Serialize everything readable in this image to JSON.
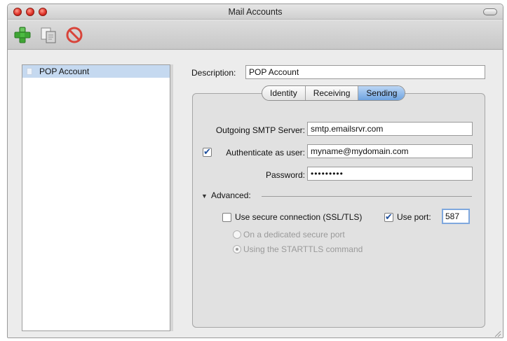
{
  "window": {
    "title": "Mail Accounts"
  },
  "toolbar": {
    "buttons": [
      {
        "name": "add-account-button",
        "icon": "plus-icon"
      },
      {
        "name": "duplicate-account-button",
        "icon": "duplicate-icon"
      },
      {
        "name": "delete-account-button",
        "icon": "no-entry-icon"
      }
    ]
  },
  "sidebar": {
    "items": [
      {
        "label": "POP Account",
        "selected": true
      }
    ]
  },
  "description": {
    "label": "Description:",
    "value": "POP Account"
  },
  "tabs": [
    {
      "label": "Identity",
      "active": false
    },
    {
      "label": "Receiving",
      "active": false
    },
    {
      "label": "Sending",
      "active": true
    }
  ],
  "sending": {
    "smtp_label": "Outgoing SMTP Server:",
    "smtp_value": "smtp.emailsrvr.com",
    "auth_label": "Authenticate as user:",
    "auth_checked": true,
    "auth_value": "myname@mydomain.com",
    "password_label": "Password:",
    "password_value": "•••••••••",
    "advanced_label": "Advanced:",
    "ssl_label": "Use secure connection (SSL/TLS)",
    "ssl_checked": false,
    "port_label": "Use port:",
    "port_checked": true,
    "port_value": "587",
    "radio_dedicated_label": "On a dedicated secure port",
    "radio_starttls_label": "Using the STARTTLS command",
    "radio_selected": "starttls"
  },
  "colors": {
    "accent": "#6ea3e0",
    "selection": "#c5d9f0",
    "add_green": "#3fa535",
    "delete_red": "#d8443a"
  }
}
